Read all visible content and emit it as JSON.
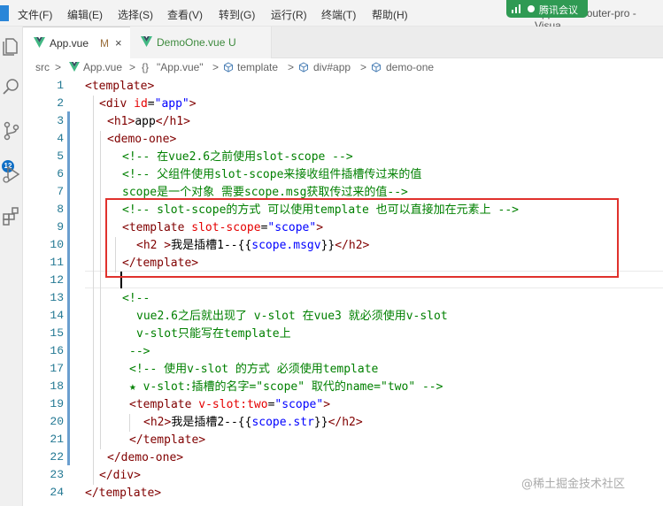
{
  "menubar": {
    "items": [
      "文件(F)",
      "编辑(E)",
      "选择(S)",
      "查看(V)",
      "转到(G)",
      "运行(R)",
      "终端(T)",
      "帮助(H)"
    ],
    "title": "App.vue - router-pro - Visua",
    "meeting_label": "腾讯会议"
  },
  "activity": {
    "badge": "12"
  },
  "tabs": [
    {
      "name": "App.vue",
      "status": "M",
      "close": "×"
    },
    {
      "name": "DemoOne.vue",
      "status": "U"
    }
  ],
  "breadcrumb": {
    "items": [
      "src",
      "App.vue",
      "\"App.vue\"",
      "template",
      "div#app",
      "demo-one"
    ],
    "separator": ">",
    "braces": "{}"
  },
  "editor": {
    "line_numbers": [
      "1",
      "2",
      "3",
      "4",
      "5",
      "6",
      "7",
      "8",
      "9",
      "10",
      "11",
      "12",
      "13",
      "14",
      "15",
      "16",
      "17",
      "18",
      "19",
      "20",
      "21",
      "22",
      "23",
      "24"
    ],
    "lines": [
      [
        [
          "tg",
          "<template>"
        ]
      ],
      [
        [
          "tg",
          "<div "
        ],
        [
          "at",
          "id"
        ],
        [
          "tx",
          "="
        ],
        [
          "st",
          "\"app\""
        ],
        [
          "tg",
          ">"
        ]
      ],
      [
        [
          "tg",
          "<h1>"
        ],
        [
          "tx",
          "app"
        ],
        [
          "tg",
          "</h1>"
        ]
      ],
      [
        [
          "tg",
          "<demo-one>"
        ]
      ],
      [
        [
          "cm",
          "<!-- 在vue2.6之前使用slot-scope -->"
        ]
      ],
      [
        [
          "cm",
          "<!-- 父组件使用slot-scope来接收组件插槽传过来的值"
        ]
      ],
      [
        [
          "cm",
          "scope是一个对象 需要scope.msg获取传过来的值-->"
        ]
      ],
      [
        [
          "cm",
          "<!-- slot-scope的方式 可以使用template 也可以直接加在元素上 -->"
        ]
      ],
      [
        [
          "tg",
          "<template "
        ],
        [
          "at",
          "slot-scope"
        ],
        [
          "tx",
          "="
        ],
        [
          "st",
          "\"scope\""
        ],
        [
          "tg",
          ">"
        ]
      ],
      [
        [
          "tg",
          "<h2 >"
        ],
        [
          "tx",
          "我是插槽1--{{"
        ],
        [
          "st",
          "scope.msgv"
        ],
        [
          "tx",
          "}}"
        ],
        [
          "tg",
          "</h2>"
        ]
      ],
      [
        [
          "tg",
          "</template>"
        ]
      ],
      [],
      [
        [
          "cm",
          "<!--"
        ]
      ],
      [
        [
          "cm",
          "vue2.6之后就出现了 v-slot 在vue3 就必须使用v-slot"
        ]
      ],
      [
        [
          "cm",
          "v-slot只能写在template上"
        ]
      ],
      [
        [
          "cm",
          "-->"
        ]
      ],
      [
        [
          "cm",
          "<!-- 使用v-slot 的方式 必须使用template"
        ]
      ],
      [
        [
          "cm",
          "★ v-slot:插槽的名字=\"scope\" 取代的name=\"two\" -->"
        ]
      ],
      [
        [
          "tg",
          "<template "
        ],
        [
          "at",
          "v-slot:two"
        ],
        [
          "tx",
          "="
        ],
        [
          "st",
          "\"scope\""
        ],
        [
          "tg",
          ">"
        ]
      ],
      [
        [
          "tg",
          "<h2>"
        ],
        [
          "tx",
          "我是插槽2--{{"
        ],
        [
          "st",
          "scope.str"
        ],
        [
          "tx",
          "}}"
        ],
        [
          "tg",
          "</h2>"
        ]
      ],
      [
        [
          "tg",
          "</template>"
        ]
      ],
      [
        [
          "tg",
          "</demo-one>"
        ]
      ],
      [
        [
          "tg",
          "</div>"
        ]
      ],
      [
        [
          "tg",
          "</template>"
        ]
      ]
    ]
  },
  "watermark": "@稀土掘金技术社区"
}
